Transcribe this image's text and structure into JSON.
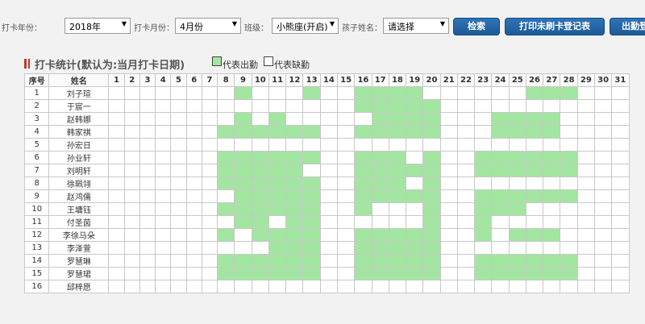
{
  "filters": {
    "year_label": "打卡年份：",
    "year_value": "2018年",
    "month_label": "打卡月份：",
    "month_value": "4月份",
    "class_label": "班级：",
    "class_value": "小熊座(开启)",
    "child_label": "孩子姓名：",
    "child_value": "请选择"
  },
  "buttons": {
    "search": "检索",
    "print": "打印未刷卡登记表",
    "attendance": "出勤登"
  },
  "section": {
    "title": "打卡统计(默认为:当月打卡日期)",
    "legend_present": "代表出勤",
    "legend_absent": "代表缺勤"
  },
  "colors": {
    "present": "#a3e6a1",
    "accent": "#2f74b6",
    "title_marker": "#c0392b"
  },
  "table": {
    "headers": [
      "序号",
      "姓名",
      "1",
      "2",
      "3",
      "4",
      "5",
      "6",
      "7",
      "8",
      "9",
      "10",
      "11",
      "12",
      "13",
      "14",
      "15",
      "16",
      "17",
      "18",
      "19",
      "20",
      "21",
      "22",
      "23",
      "24",
      "25",
      "26",
      "27",
      "28",
      "29",
      "30",
      "31"
    ],
    "rows": [
      {
        "no": "1",
        "name": "刘子瑄",
        "present": [
          9,
          13,
          16,
          17,
          18,
          19,
          26,
          27,
          28
        ]
      },
      {
        "no": "2",
        "name": "于宸一",
        "present": [
          16,
          17,
          18,
          19,
          20
        ]
      },
      {
        "no": "3",
        "name": "赵韩娜",
        "present": [
          9,
          11,
          17,
          18,
          19,
          20,
          24,
          25,
          26,
          27
        ]
      },
      {
        "no": "4",
        "name": "韩家祺",
        "present": [
          8,
          9,
          10,
          11,
          12,
          13,
          16,
          17,
          18,
          19,
          20,
          24,
          25,
          26,
          27
        ]
      },
      {
        "no": "5",
        "name": "孙宏日",
        "present": []
      },
      {
        "no": "6",
        "name": "孙业轩",
        "present": [
          8,
          9,
          10,
          11,
          12,
          13,
          16,
          17,
          18,
          20,
          23,
          24,
          25,
          26,
          27,
          28
        ]
      },
      {
        "no": "7",
        "name": "刘明轩",
        "present": [
          8,
          9,
          10,
          11,
          12,
          16,
          17,
          18,
          19,
          20,
          23,
          24,
          25,
          26,
          27,
          28
        ]
      },
      {
        "no": "8",
        "name": "徐珮翎",
        "present": [
          8,
          9,
          10,
          11,
          12,
          13,
          16,
          17,
          18,
          20
        ]
      },
      {
        "no": "9",
        "name": "赵鸿儒",
        "present": [
          9,
          10,
          11,
          12,
          13,
          16,
          17,
          18,
          19,
          20,
          23,
          24,
          25,
          26,
          27,
          28
        ]
      },
      {
        "no": "10",
        "name": "王墉钰",
        "present": [
          8,
          9,
          10,
          11,
          12,
          13,
          16,
          20,
          23,
          24,
          25
        ]
      },
      {
        "no": "11",
        "name": "付圣茵",
        "present": [
          9,
          10,
          12,
          13,
          20,
          23
        ]
      },
      {
        "no": "12",
        "name": "李徐马朵",
        "present": [
          8,
          10,
          11,
          12,
          13,
          16,
          17,
          18,
          19,
          20,
          23,
          25,
          26,
          27
        ]
      },
      {
        "no": "13",
        "name": "李泽萱",
        "present": [
          11,
          12,
          13,
          16,
          17,
          18,
          19,
          20
        ]
      },
      {
        "no": "14",
        "name": "罗慧琳",
        "present": [
          8,
          9,
          10,
          11,
          12,
          13,
          16,
          17,
          18,
          19,
          20,
          23,
          24,
          25,
          26,
          27,
          28
        ]
      },
      {
        "no": "15",
        "name": "罗慧珺",
        "present": [
          8,
          9,
          10,
          11,
          12,
          13,
          16,
          17,
          18,
          19,
          20,
          23,
          24,
          25,
          26,
          27,
          28
        ]
      },
      {
        "no": "16",
        "name": "邱梓愿",
        "present": []
      }
    ]
  }
}
